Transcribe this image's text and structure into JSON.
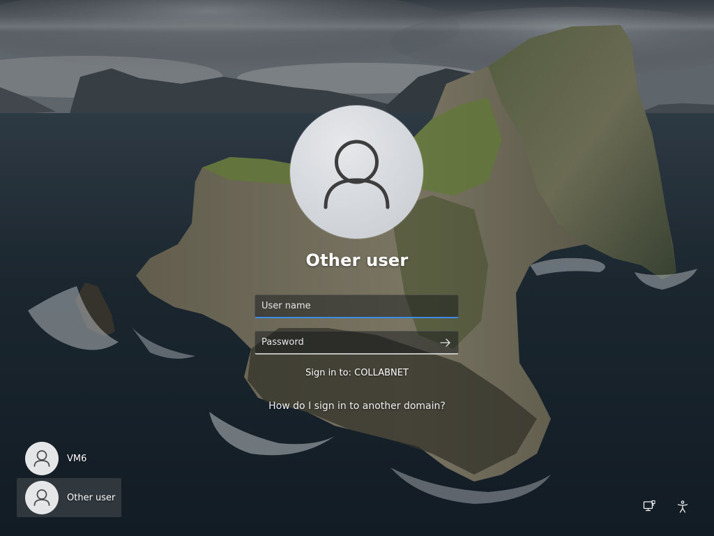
{
  "colors": {
    "accent": "#3c8ce6",
    "avatar_bg": "#d4d7db",
    "field_bg": "rgba(18,24,28,0.48)",
    "selected_tile_bg": "rgba(60,66,72,0.72)"
  },
  "lock_screen": {
    "avatar_icon": "person-icon",
    "display_name": "Other user",
    "username_field": {
      "placeholder": "User name",
      "value": ""
    },
    "password_field": {
      "placeholder": "Password",
      "value": "",
      "submit_icon": "arrow-right-icon"
    },
    "sign_in_to": "Sign in to: COLLABNET",
    "other_domain_link": "How do I sign in to another domain?"
  },
  "user_list": [
    {
      "name": "VM6",
      "icon": "person-icon",
      "selected": false
    },
    {
      "name": "Other user",
      "icon": "person-icon",
      "selected": true
    }
  ],
  "system_buttons": {
    "network_icon": "network-icon",
    "accessibility_icon": "accessibility-icon"
  }
}
